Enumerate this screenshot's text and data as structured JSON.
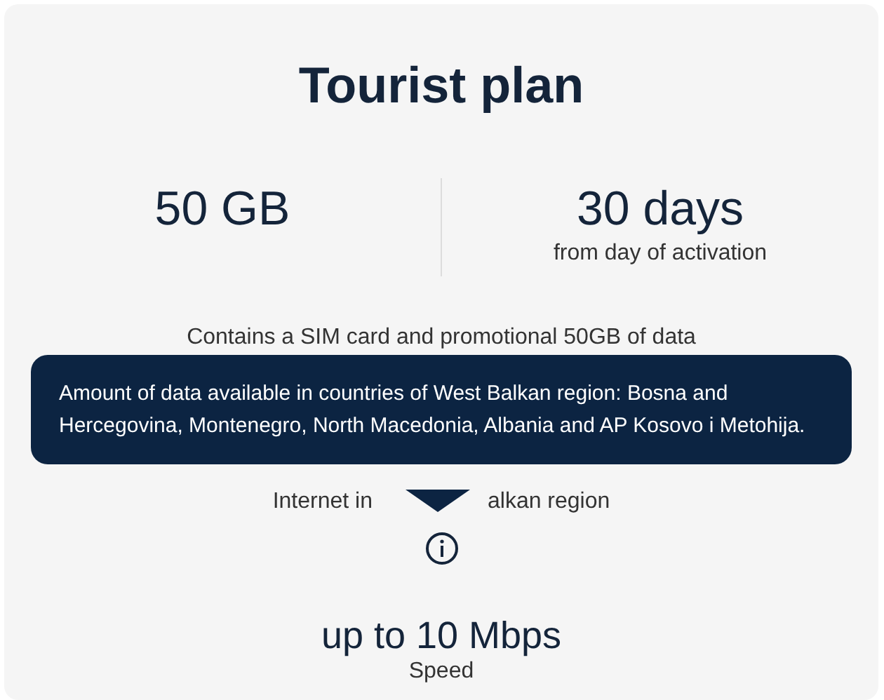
{
  "title": "Tourist plan",
  "stats": [
    {
      "value": "50 GB"
    },
    {
      "value": "30 days",
      "note": "from day of activation"
    }
  ],
  "description": "Contains a SIM card and promotional 50GB of data",
  "partial_line": [
    "Internet in",
    "alkan region"
  ],
  "tooltip": {
    "text": "Amount of data available in countries of West Balkan region: Bosna and Hercegovina, Montenegro, North Macedonia, Albania and AP Kosovo i Metohija."
  },
  "speed": {
    "value": "up to 10 Mbps",
    "label": "Speed"
  }
}
